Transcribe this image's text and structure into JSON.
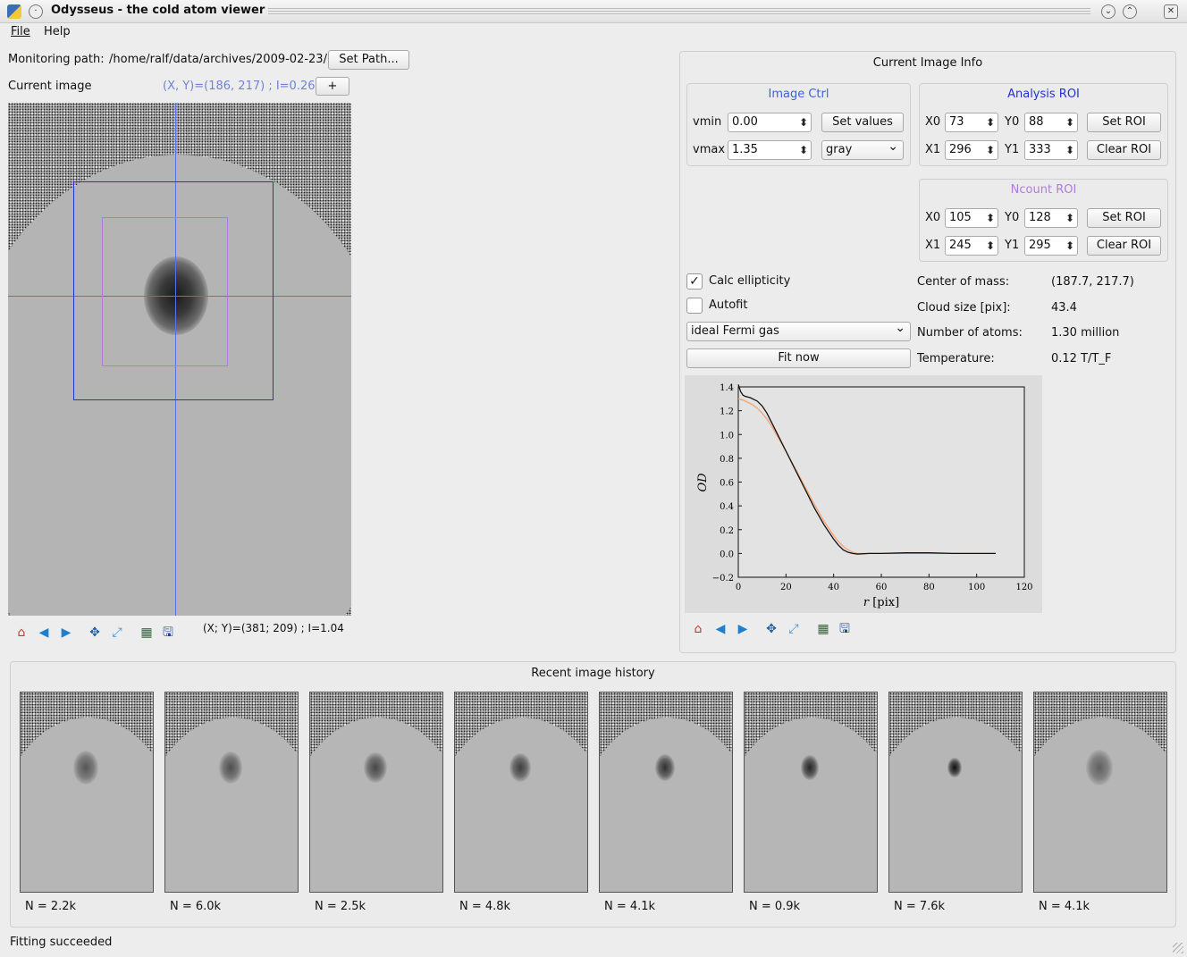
{
  "window": {
    "title": "Odysseus - the cold atom viewer"
  },
  "menu": {
    "file": "File",
    "help": "Help"
  },
  "monitor": {
    "label": "Monitoring path:",
    "path": "/home/ralf/data/archives/2009-02-23/",
    "set_path": "Set Path..."
  },
  "current_image": {
    "label": "Current image",
    "cursor_readout": "(X, Y)=(186, 217) ;  I=0.26",
    "plus": "+",
    "bottom_readout": "(X; Y)=(381; 209) ;  I=1.04"
  },
  "info": {
    "title": "Current Image Info"
  },
  "image_ctrl": {
    "title": "Image Ctrl",
    "vmin_label": "vmin",
    "vmin": "0.00",
    "vmax_label": "vmax",
    "vmax": "1.35",
    "set_values": "Set values",
    "colormap": "gray"
  },
  "analysis_roi": {
    "title": "Analysis ROI",
    "x0_label": "X0",
    "x0": "73",
    "y0_label": "Y0",
    "y0": "88",
    "x1_label": "X1",
    "x1": "296",
    "y1_label": "Y1",
    "y1": "333",
    "set": "Set ROI",
    "clear": "Clear ROI"
  },
  "ncount_roi": {
    "title": "Ncount ROI",
    "x0_label": "X0",
    "x0": "105",
    "y0_label": "Y0",
    "y0": "128",
    "x1_label": "X1",
    "x1": "245",
    "y1_label": "Y1",
    "y1": "295",
    "set": "Set ROI",
    "clear": "Clear ROI"
  },
  "fit": {
    "calc_ellipticity": "Calc ellipticity",
    "autofit": "Autofit",
    "model": "ideal Fermi gas",
    "fit_now": "Fit now"
  },
  "results": {
    "center_label": "Center of mass:",
    "center": "(187.7, 217.7)",
    "size_label": "Cloud size [pix]:",
    "size": "43.4",
    "atoms_label": "Number of atoms:",
    "atoms": "1.30 million",
    "temp_label": "Temperature:",
    "temp": "0.12 T/T_F"
  },
  "chart_data": {
    "type": "line",
    "xlabel": "r [pix]",
    "ylabel": "OD",
    "xlim": [
      0,
      120
    ],
    "ylim": [
      -0.2,
      1.4
    ],
    "xticks": [
      "0",
      "20",
      "40",
      "60",
      "80",
      "100",
      "120"
    ],
    "yticks": [
      "1.4",
      "1.2",
      "1.0",
      "0.8",
      "0.6",
      "0.4",
      "0.2",
      "0.0",
      "−0.2"
    ],
    "series": [
      {
        "color": "#111111",
        "x": [
          0,
          1,
          2,
          3,
          5,
          8,
          10,
          12,
          14,
          16,
          20,
          24,
          28,
          32,
          36,
          40,
          42,
          44,
          46,
          48,
          50,
          55,
          60,
          70,
          80,
          90,
          100,
          108
        ],
        "y": [
          1.42,
          1.36,
          1.33,
          1.32,
          1.31,
          1.28,
          1.24,
          1.18,
          1.1,
          1.02,
          0.86,
          0.7,
          0.54,
          0.38,
          0.24,
          0.12,
          0.07,
          0.03,
          0.01,
          0.0,
          -0.005,
          0.0,
          0.0,
          0.005,
          0.005,
          0.0,
          0.0,
          0.0
        ]
      },
      {
        "color": "#f4a070",
        "x": [
          0,
          2,
          4,
          6,
          8,
          10,
          12,
          14,
          16,
          20,
          24,
          28,
          32,
          36,
          40,
          42,
          44,
          46,
          48,
          50,
          55,
          60,
          70,
          80,
          90,
          100,
          108
        ],
        "y": [
          1.3,
          1.29,
          1.27,
          1.25,
          1.22,
          1.18,
          1.13,
          1.07,
          1.0,
          0.86,
          0.71,
          0.56,
          0.41,
          0.27,
          0.15,
          0.1,
          0.06,
          0.03,
          0.01,
          0.0,
          0.0,
          0.0,
          0.0,
          0.0,
          0.0,
          0.0,
          0.0
        ]
      }
    ]
  },
  "history": {
    "title": "Recent image history",
    "items": [
      {
        "label": "N = 2.2k",
        "darkness": 0.55,
        "size": 1.0
      },
      {
        "label": "N = 6.0k",
        "darkness": 0.6,
        "size": 0.95
      },
      {
        "label": "N = 2.5k",
        "darkness": 0.65,
        "size": 0.9
      },
      {
        "label": "N = 4.8k",
        "darkness": 0.7,
        "size": 0.85
      },
      {
        "label": "N = 4.1k",
        "darkness": 0.78,
        "size": 0.8
      },
      {
        "label": "N = 0.9k",
        "darkness": 0.85,
        "size": 0.72
      },
      {
        "label": "N = 7.6k",
        "darkness": 0.97,
        "size": 0.6
      },
      {
        "label": "N = 4.1k",
        "darkness": 0.5,
        "size": 1.05
      }
    ]
  },
  "status": "Fitting succeeded"
}
